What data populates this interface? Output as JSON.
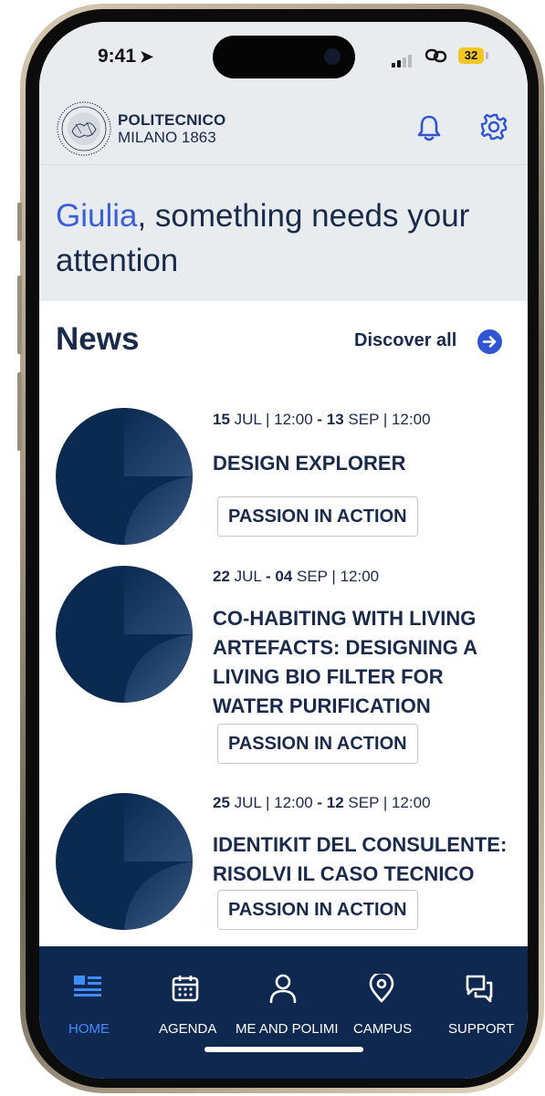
{
  "status": {
    "time": "9:41",
    "battery": "32"
  },
  "header": {
    "brand_line1": "POLITECNICO",
    "brand_line2": "MILANO 1863",
    "notification_icon": "bell-icon",
    "settings_icon": "gear-icon"
  },
  "greeting": {
    "name": "Giulia",
    "message": ", something needs your attention"
  },
  "news": {
    "title": "News",
    "discover_label": "Discover all",
    "items": [
      {
        "date_start_day": "15",
        "date_start_rest": " JUL | 12:00 ",
        "date_sep": "-",
        "date_end_day": " 13",
        "date_end_rest": " SEP | 12:00",
        "headline": "DESIGN EXPLORER",
        "tag": "PASSION IN ACTION"
      },
      {
        "date_start_day": "22",
        "date_start_rest": " JUL ",
        "date_sep": "-",
        "date_end_day": " 04",
        "date_end_rest": " SEP | 12:00",
        "headline": "CO-HABITING WITH LIVING ARTEFACTS: DESIGNING A LIVING BIO FILTER FOR WATER PURIFICATION",
        "tag": "PASSION IN ACTION"
      },
      {
        "date_start_day": "25",
        "date_start_rest": " JUL | 12:00 ",
        "date_sep": "-",
        "date_end_day": " 12",
        "date_end_rest": " SEP | 12:00",
        "headline": "IDENTIKIT DEL CONSULENTE: RISOLVI IL CASO TECNICO",
        "tag": "PASSION IN ACTION"
      }
    ]
  },
  "tabbar": {
    "home": "HOME",
    "agenda": "AGENDA",
    "me": "ME AND POLIMI",
    "campus": "CAMPUS",
    "support": "SUPPORT"
  },
  "colors": {
    "accent": "#3a5fd6",
    "navy": "#0f2850",
    "active_tab": "#3f8cff",
    "top_bg": "#e8ecef"
  }
}
